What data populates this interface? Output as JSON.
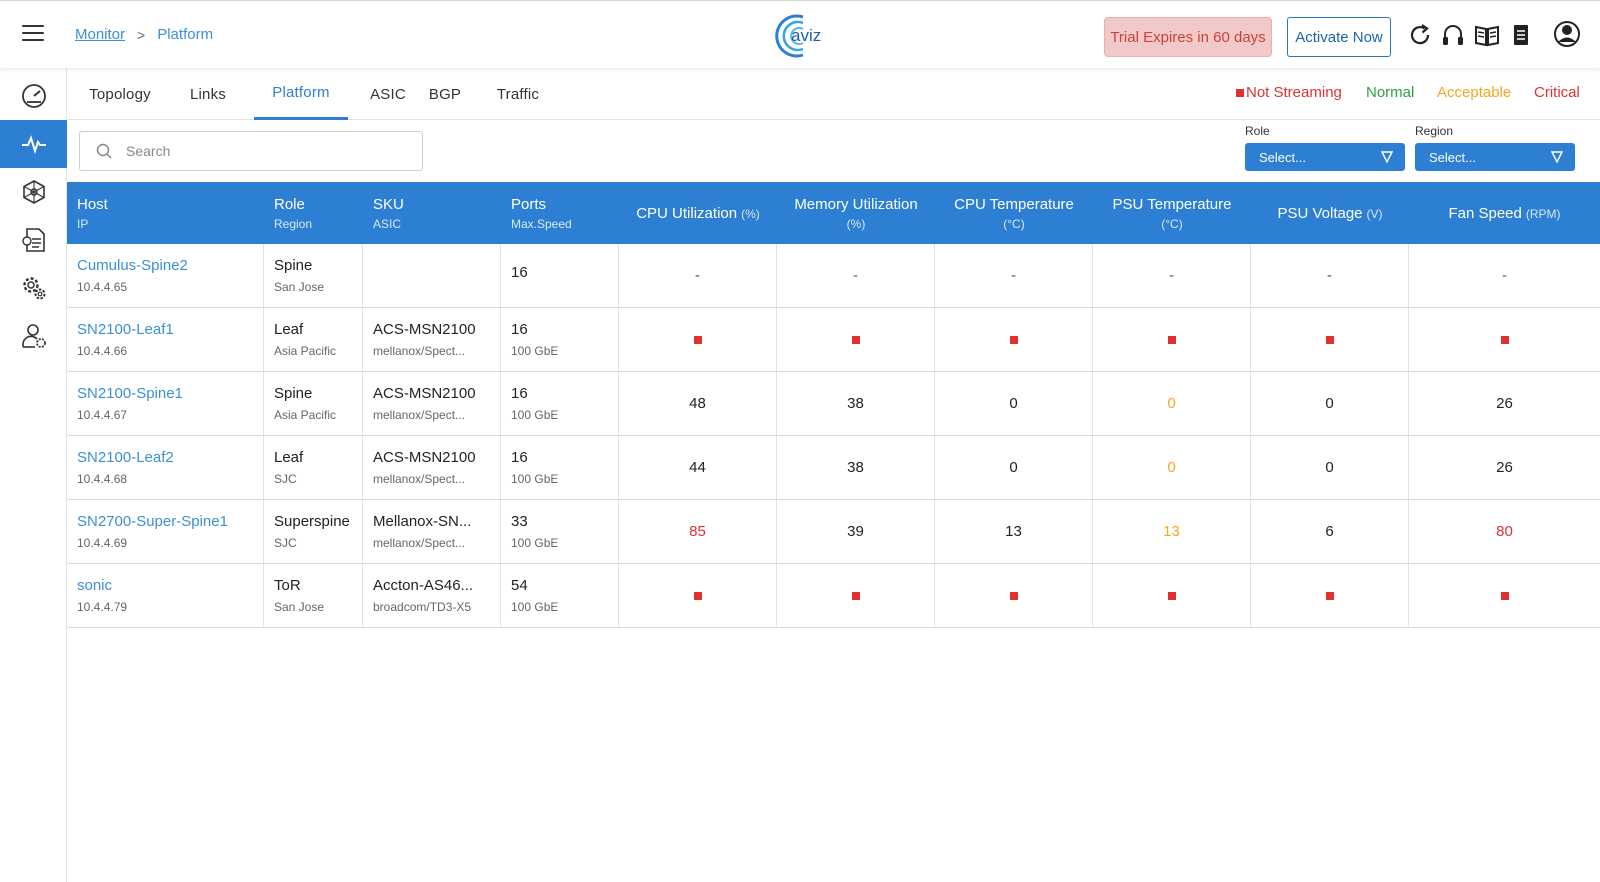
{
  "breadcrumb": {
    "root": "Monitor",
    "separator": ">",
    "current": "Platform"
  },
  "header": {
    "trial": "Trial Expires in 60 days",
    "activate": "Activate Now"
  },
  "tabs": [
    "Topology",
    "Links",
    "Platform",
    "ASIC",
    "BGP",
    "Traffic"
  ],
  "active_tab": "Platform",
  "legend": {
    "not_streaming": "Not Streaming",
    "normal": "Normal",
    "acceptable": "Acceptable",
    "critical": "Critical"
  },
  "colors": {
    "accent": "#2d7fd3",
    "not_streaming": "#e03131",
    "normal": "#2f9e44",
    "acceptable": "#f5a623",
    "critical": "#e03131"
  },
  "search": {
    "placeholder": "Search"
  },
  "filters": {
    "role_label": "Role",
    "role_value": "Select...",
    "region_label": "Region",
    "region_value": "Select..."
  },
  "table": {
    "columns": [
      {
        "main": "Host",
        "sub": "IP"
      },
      {
        "main": "Role",
        "sub": "Region"
      },
      {
        "main": "SKU",
        "sub": "ASIC"
      },
      {
        "main": "Ports",
        "sub": "Max.Speed"
      },
      {
        "main": "CPU Utilization",
        "unit": "(%)"
      },
      {
        "main": "Memory Utilization",
        "sub": "(%)"
      },
      {
        "main": "CPU Temperature",
        "sub": "(°C)"
      },
      {
        "main": "PSU Temperature",
        "sub": "(°C)"
      },
      {
        "main": "PSU Voltage",
        "unit": "(V)"
      },
      {
        "main": "Fan Speed",
        "unit": "(RPM)"
      }
    ],
    "rows": [
      {
        "host": "Cumulus-Spine2",
        "ip": "10.4.4.65",
        "role": "Spine",
        "region": "San Jose",
        "sku": "",
        "asic": "",
        "ports": "16",
        "speed": "",
        "metrics": [
          {
            "v": "-",
            "s": "dash"
          },
          {
            "v": "-",
            "s": "dash"
          },
          {
            "v": "-",
            "s": "dash"
          },
          {
            "v": "-",
            "s": "dash"
          },
          {
            "v": "-",
            "s": "dash"
          },
          {
            "v": "-",
            "s": "dash"
          }
        ]
      },
      {
        "host": "SN2100-Leaf1",
        "ip": "10.4.4.66",
        "role": "Leaf",
        "region": "Asia Pacific",
        "sku": "ACS-MSN2100",
        "asic": "mellanox/Spect...",
        "ports": "16",
        "speed": "100 GbE",
        "metrics": [
          {
            "v": "",
            "s": "not_streaming"
          },
          {
            "v": "",
            "s": "not_streaming"
          },
          {
            "v": "",
            "s": "not_streaming"
          },
          {
            "v": "",
            "s": "not_streaming"
          },
          {
            "v": "",
            "s": "not_streaming"
          },
          {
            "v": "",
            "s": "not_streaming"
          }
        ]
      },
      {
        "host": "SN2100-Spine1",
        "ip": "10.4.4.67",
        "role": "Spine",
        "region": "Asia Pacific",
        "sku": "ACS-MSN2100",
        "asic": "mellanox/Spect...",
        "ports": "16",
        "speed": "100 GbE",
        "metrics": [
          {
            "v": "48",
            "s": "plain"
          },
          {
            "v": "38",
            "s": "plain"
          },
          {
            "v": "0",
            "s": "plain"
          },
          {
            "v": "0",
            "s": "acceptable"
          },
          {
            "v": "0",
            "s": "plain"
          },
          {
            "v": "26",
            "s": "plain"
          }
        ]
      },
      {
        "host": "SN2100-Leaf2",
        "ip": "10.4.4.68",
        "role": "Leaf",
        "region": "SJC",
        "sku": "ACS-MSN2100",
        "asic": "mellanox/Spect...",
        "ports": "16",
        "speed": "100 GbE",
        "metrics": [
          {
            "v": "44",
            "s": "plain"
          },
          {
            "v": "38",
            "s": "plain"
          },
          {
            "v": "0",
            "s": "plain"
          },
          {
            "v": "0",
            "s": "acceptable"
          },
          {
            "v": "0",
            "s": "plain"
          },
          {
            "v": "26",
            "s": "plain"
          }
        ]
      },
      {
        "host": "SN2700-Super-Spine1",
        "ip": "10.4.4.69",
        "role": "Superspine",
        "region": "SJC",
        "sku": "Mellanox-SN...",
        "asic": "mellanox/Spect...",
        "ports": "33",
        "speed": "100 GbE",
        "metrics": [
          {
            "v": "85",
            "s": "critical"
          },
          {
            "v": "39",
            "s": "plain"
          },
          {
            "v": "13",
            "s": "plain"
          },
          {
            "v": "13",
            "s": "acceptable"
          },
          {
            "v": "6",
            "s": "plain"
          },
          {
            "v": "80",
            "s": "critical"
          }
        ]
      },
      {
        "host": "sonic",
        "ip": "10.4.4.79",
        "role": "ToR",
        "region": "San Jose",
        "sku": "Accton-AS46...",
        "asic": "broadcom/TD3-X5",
        "ports": "54",
        "speed": "100 GbE",
        "metrics": [
          {
            "v": "",
            "s": "not_streaming"
          },
          {
            "v": "",
            "s": "not_streaming"
          },
          {
            "v": "",
            "s": "not_streaming"
          },
          {
            "v": "",
            "s": "not_streaming"
          },
          {
            "v": "",
            "s": "not_streaming"
          },
          {
            "v": "",
            "s": "not_streaming"
          }
        ]
      }
    ]
  },
  "sidebar": {
    "items": [
      {
        "icon": "dashboard-gauge-icon"
      },
      {
        "icon": "monitor-pulse-icon",
        "active": true
      },
      {
        "icon": "network-cube-icon"
      },
      {
        "icon": "config-document-icon"
      },
      {
        "icon": "settings-gears-icon"
      },
      {
        "icon": "user-settings-icon"
      }
    ]
  }
}
